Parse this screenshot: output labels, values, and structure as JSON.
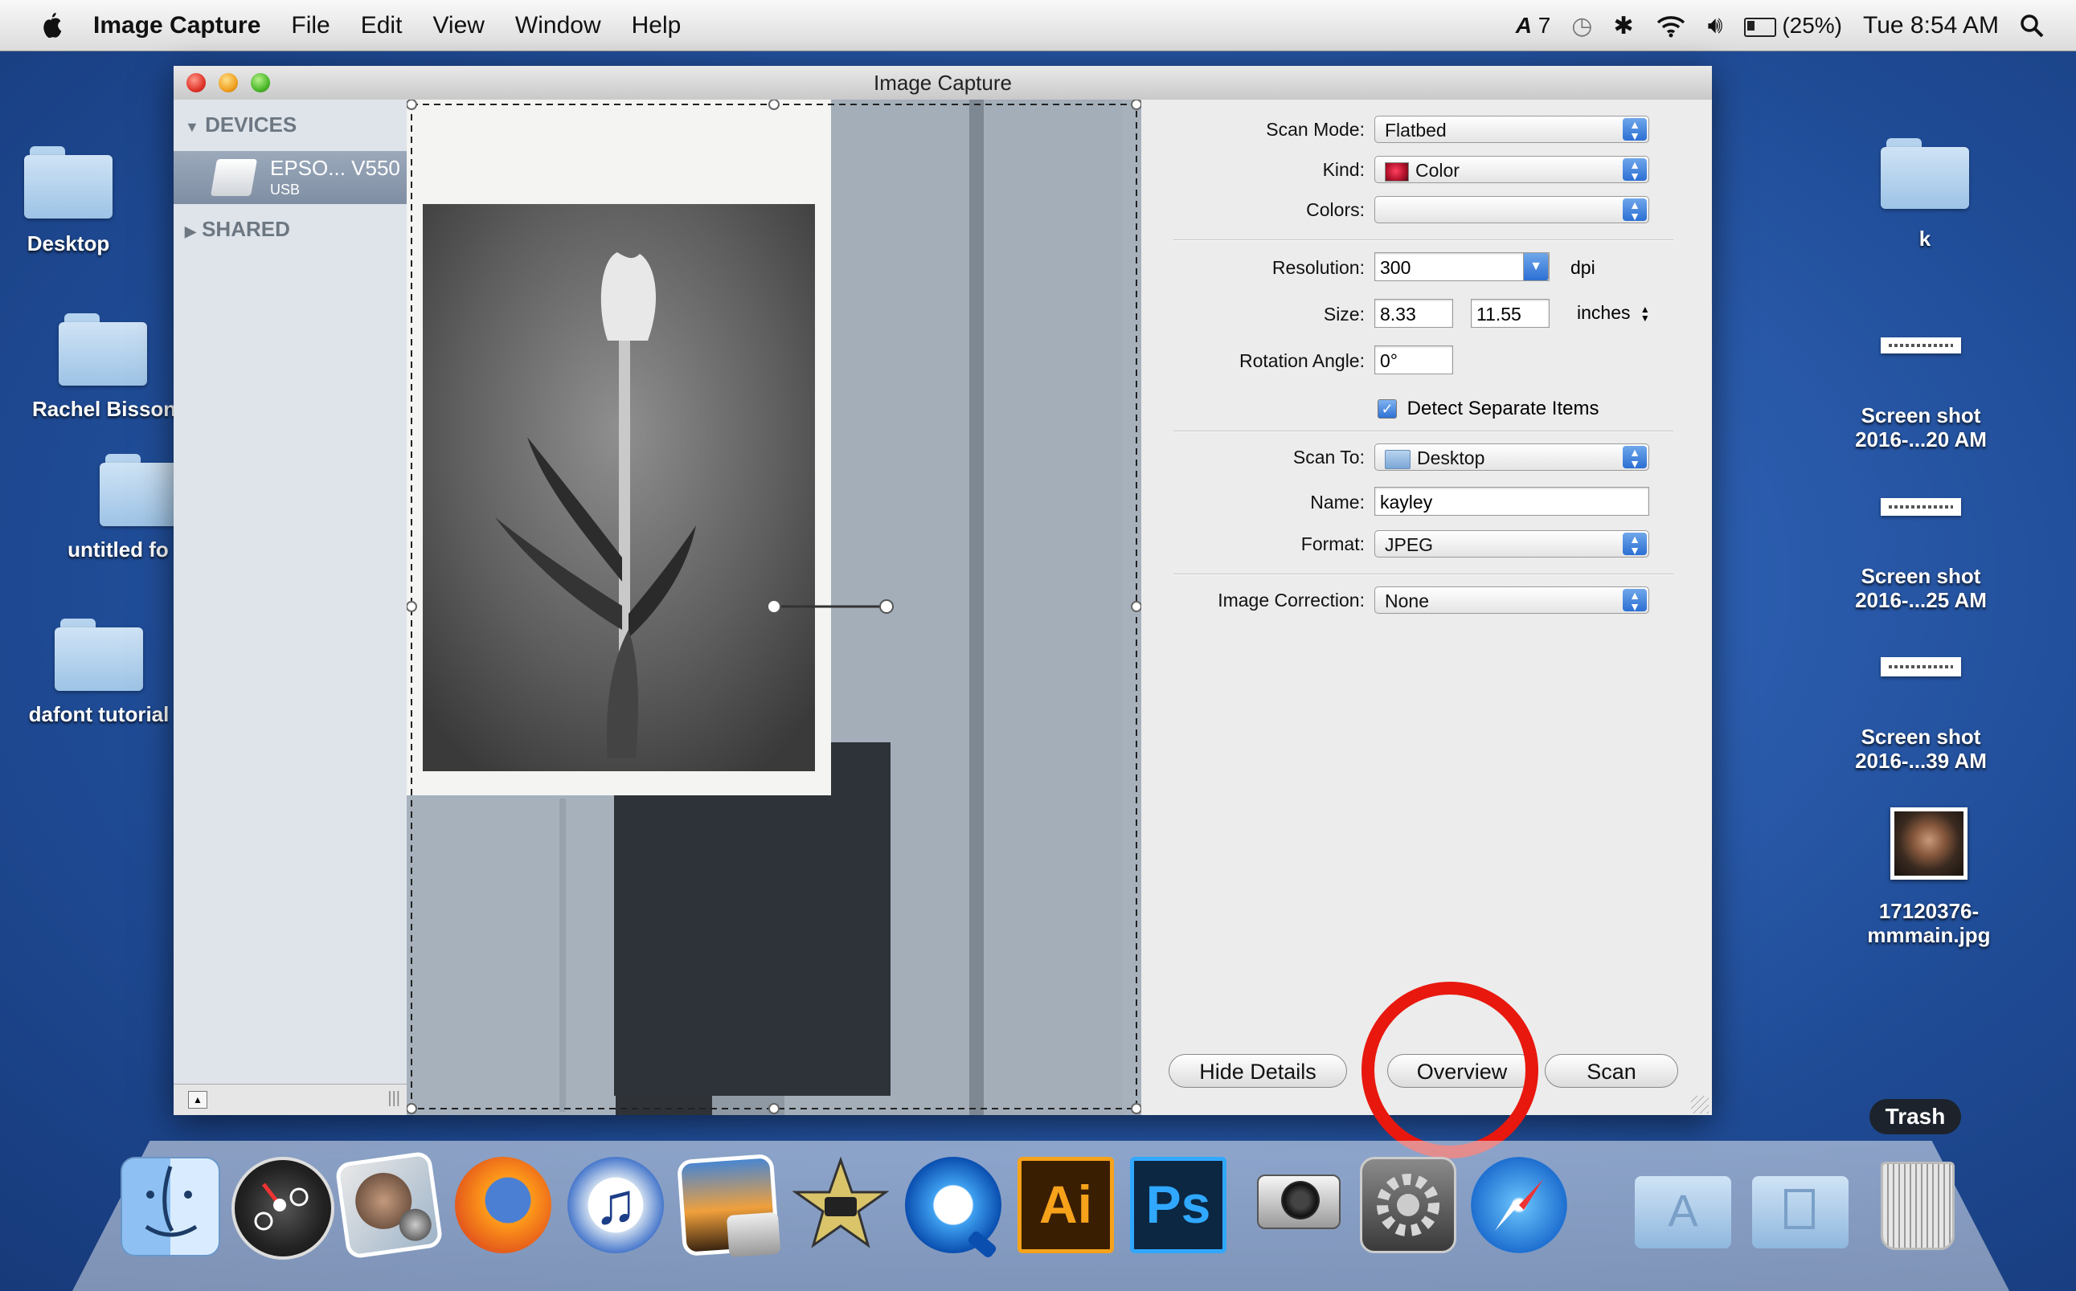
{
  "menubar": {
    "app_name": "Image Capture",
    "menus": [
      "File",
      "Edit",
      "View",
      "Window",
      "Help"
    ],
    "status_adobe": "7",
    "battery": "(25%)",
    "clock": "Tue 8:54 AM"
  },
  "desktop": {
    "left_icons": [
      "Desktop",
      "Rachel Bisson",
      "untitled fo",
      "dafont tutorial"
    ],
    "right_icons": [
      {
        "label": "k"
      },
      {
        "label1": "Screen shot",
        "label2": "2016-...20 AM"
      },
      {
        "label1": "Screen shot",
        "label2": "2016-...25 AM"
      },
      {
        "label1": "Screen shot",
        "label2": "2016-...39 AM"
      },
      {
        "label1": "17120376-",
        "label2": "mmmain.jpg"
      }
    ]
  },
  "window": {
    "title": "Image Capture",
    "sidebar": {
      "devices_header": "DEVICES",
      "device_name": "EPSO... V550",
      "device_sub": "USB",
      "shared_header": "SHARED"
    },
    "details": {
      "scan_mode_label": "Scan Mode:",
      "scan_mode_value": "Flatbed",
      "kind_label": "Kind:",
      "kind_value": "Color",
      "colors_label": "Colors:",
      "colors_value": "",
      "resolution_label": "Resolution:",
      "resolution_value": "300",
      "resolution_unit": "dpi",
      "size_label": "Size:",
      "size_width": "8.33",
      "size_height": "11.55",
      "size_unit": "inches",
      "rotation_label": "Rotation Angle:",
      "rotation_value": "0°",
      "detect_separate_label": "Detect Separate Items",
      "detect_separate_checked": true,
      "scan_to_label": "Scan To:",
      "scan_to_value": "Desktop",
      "name_label": "Name:",
      "name_value": "kayley",
      "format_label": "Format:",
      "format_value": "JPEG",
      "image_correction_label": "Image Correction:",
      "image_correction_value": "None"
    },
    "buttons": {
      "hide_details": "Hide Details",
      "overview": "Overview",
      "scan": "Scan"
    }
  },
  "dock": {
    "trash_label": "Trash",
    "apps": [
      "finder",
      "dashboard",
      "iphoto",
      "firefox",
      "itunes",
      "image-capture",
      "imovie",
      "quicktime",
      "illustrator",
      "photoshop",
      "image-capture-camera",
      "system-preferences",
      "safari",
      "applications-stack",
      "documents-stack",
      "trash"
    ],
    "illustrator_text": "Ai",
    "photoshop_text": "Ps"
  },
  "colors": {
    "annotation_circle": "#e8180e",
    "selection_blue": "#2c6fd4"
  }
}
